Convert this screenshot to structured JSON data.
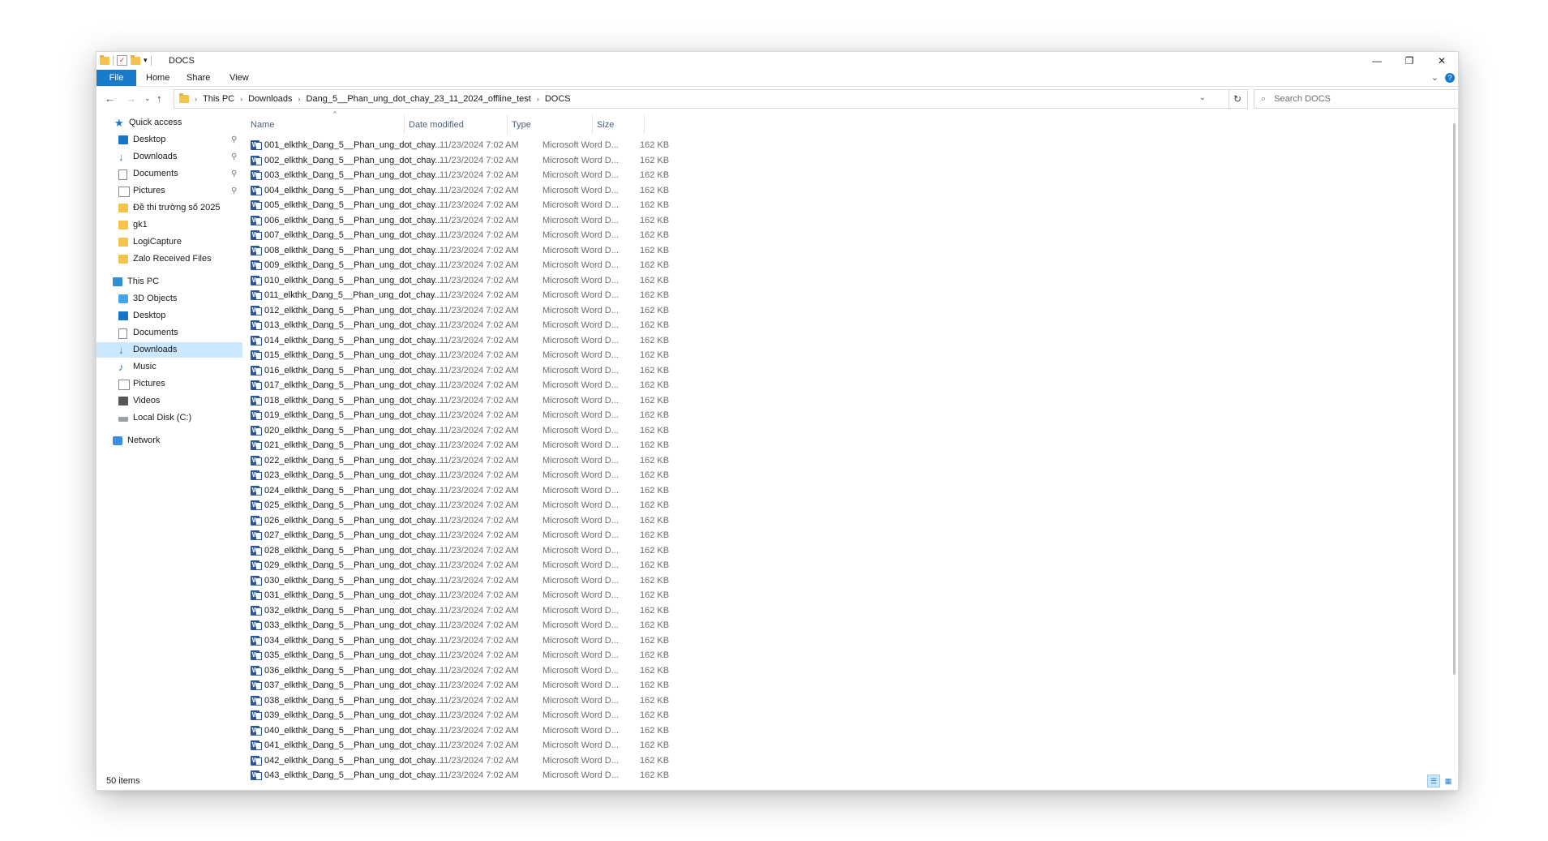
{
  "window": {
    "title": "DOCS",
    "controls": {
      "minimize": "—",
      "restore": "❐",
      "close": "✕"
    }
  },
  "ribbon": {
    "tabs": [
      "File",
      "Home",
      "Share",
      "View"
    ],
    "expand_icon": "⌄",
    "help_icon": "?"
  },
  "nav": {
    "back": "←",
    "forward": "→",
    "recent": "⌄",
    "up": "↑",
    "breadcrumb": [
      "This PC",
      "Downloads",
      "Dang_5__Phan_ung_dot_chay_23_11_2024_offline_test",
      "DOCS"
    ],
    "refresh": "↻",
    "search_placeholder": "Search DOCS"
  },
  "sidebar": {
    "items": [
      {
        "label": "Quick access",
        "icon": "star-icon",
        "pinned": false
      },
      {
        "label": "Desktop",
        "icon": "desktop-icon",
        "pinned": true
      },
      {
        "label": "Downloads",
        "icon": "download-icon",
        "pinned": true
      },
      {
        "label": "Documents",
        "icon": "documents-icon",
        "pinned": true
      },
      {
        "label": "Pictures",
        "icon": "pictures-icon",
        "pinned": true
      },
      {
        "label": "Đề thi trường số 2025",
        "icon": "folder-icon",
        "pinned": false
      },
      {
        "label": "gk1",
        "icon": "folder-icon",
        "pinned": false
      },
      {
        "label": "LogiCapture",
        "icon": "folder-icon",
        "pinned": false
      },
      {
        "label": "Zalo Received Files",
        "icon": "folder-icon",
        "pinned": false
      },
      {
        "label": "This PC",
        "icon": "pc-icon",
        "pinned": false
      },
      {
        "label": "3D Objects",
        "icon": "3d-objects-icon",
        "pinned": false
      },
      {
        "label": "Desktop",
        "icon": "desktop-icon",
        "pinned": false
      },
      {
        "label": "Documents",
        "icon": "documents-icon",
        "pinned": false
      },
      {
        "label": "Downloads",
        "icon": "download-icon",
        "pinned": false,
        "selected": true
      },
      {
        "label": "Music",
        "icon": "music-icon",
        "pinned": false
      },
      {
        "label": "Pictures",
        "icon": "pictures-icon",
        "pinned": false
      },
      {
        "label": "Videos",
        "icon": "videos-icon",
        "pinned": false
      },
      {
        "label": "Local Disk (C:)",
        "icon": "disk-icon",
        "pinned": false
      },
      {
        "label": "Network",
        "icon": "network-icon",
        "pinned": false
      }
    ]
  },
  "columns": [
    "Name",
    "Date modified",
    "Type",
    "Size"
  ],
  "file_template": {
    "name_suffix": "_elkthk_Dang_5__Phan_ung_dot_chay...",
    "date": "11/23/2024 7:02 AM",
    "type": "Microsoft Word D...",
    "size": "162 KB",
    "visible_count": 43
  },
  "status": {
    "count": "50 items"
  },
  "colors": {
    "accent": "#1979ca",
    "selection": "#cce8ff",
    "word": "#2b579a"
  }
}
